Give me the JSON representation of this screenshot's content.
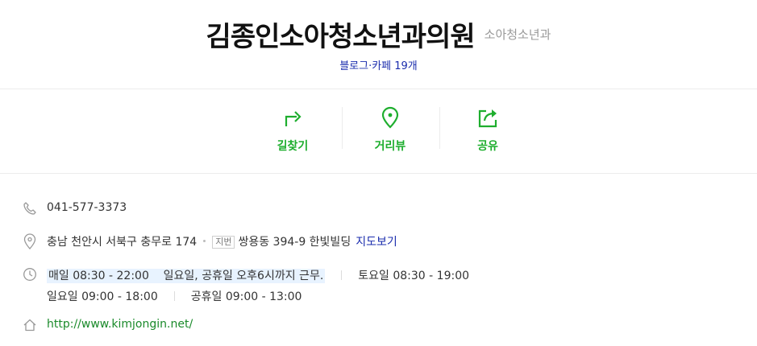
{
  "header": {
    "title": "김종인소아청소년과의원",
    "category": "소아청소년과",
    "review_link": "블로그·카페 19개"
  },
  "actions": [
    {
      "label": "길찾기",
      "icon": "directions-icon"
    },
    {
      "label": "거리뷰",
      "icon": "map-pin-icon"
    },
    {
      "label": "공유",
      "icon": "share-icon"
    }
  ],
  "info": {
    "phone": "041-577-3373",
    "address": "충남 천안시 서북구 충무로 174",
    "jibun_badge": "지번",
    "jibun_address": "쌍용동 394-9 한빛빌딩",
    "map_link": "지도보기",
    "hours": {
      "weekday": "매일 08:30 - 22:00",
      "weekday_note": "일요일, 공휴일 오후6시까지 근무.",
      "saturday": "토요일 08:30 - 19:00",
      "sunday": "일요일 09:00 - 18:00",
      "holiday": "공휴일 09:00 - 13:00"
    },
    "website": "http://www.kimjongin.net/"
  },
  "colors": {
    "accent_green": "#1eae2e",
    "link_blue": "#1a2cad",
    "url_green": "#1a8a2a",
    "highlight": "#e8f3ff"
  }
}
